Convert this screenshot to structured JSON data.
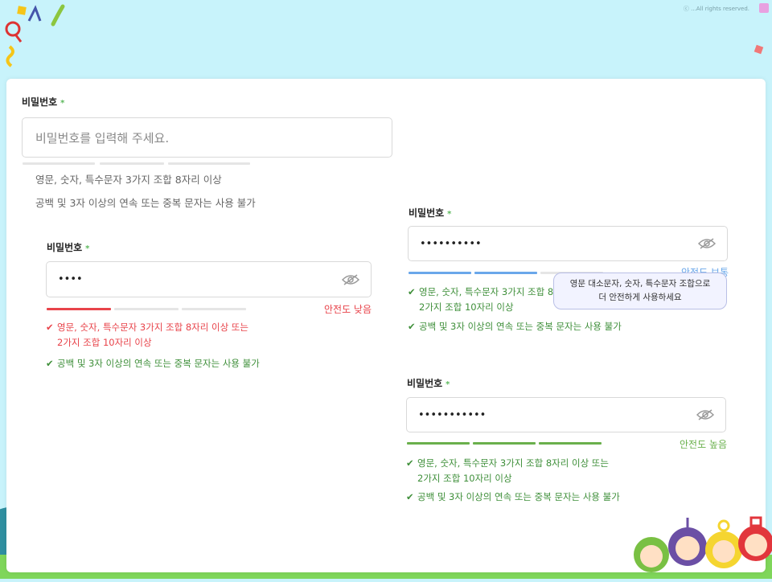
{
  "copyright": "ⓒ ...All rights reserved.",
  "colors": {
    "background": "#c8f3fb",
    "required": "#5cb85c",
    "weak": "#e8434a",
    "medium": "#6aa7ea",
    "strong": "#6ab04c",
    "tooltip_bg": "#f2f3ff"
  },
  "example1": {
    "label": "비밀번호",
    "required_mark": "*",
    "placeholder": "비밀번호를 입력해 주세요.",
    "hint1": "영문, 숫자, 특수문자 3가지 조합 8자리 이상",
    "hint2": "공백 및 3자 이상의 연속 또는 중복 문자는 사용 불가"
  },
  "example2": {
    "label": "비밀번호",
    "required_mark": "*",
    "value": "••••",
    "eye_icon": "eye-icon",
    "strength": "안전도 낮음",
    "strength_level": 1,
    "rule1_mark": "✔",
    "rule1_line1": "영문, 숫자, 특수문자 3가지 조합 8자리 이상 또는",
    "rule1_line2": "2가지 조합 10자리 이상",
    "rule2_mark": "✔",
    "rule2": "공백 및 3자 이상의 연속 또는 중복 문자는 사용 불가"
  },
  "example3": {
    "label": "비밀번호",
    "required_mark": "*",
    "value": "••••••••••",
    "eye_icon": "eye-icon",
    "strength": "안전도 보통",
    "strength_level": 2,
    "rule1_mark": "✔",
    "rule1_line1": "영문, 숫자, 특수문자 3가지 조합 8자리 이상 또는",
    "rule1_line2": "2가지 조합 10자리 이상",
    "rule2_mark": "✔",
    "rule2": "공백 및 3자 이상의 연속 또는 중복 문자는 사용 불가",
    "tooltip_line1": "영문 대소문자, 숫자, 특수문자 조합으로",
    "tooltip_line2": "더 안전하게 사용하세요"
  },
  "example4": {
    "label": "비밀번호",
    "required_mark": "*",
    "value": "•••••••••••",
    "eye_icon": "eye-icon",
    "strength": "안전도 높음",
    "strength_level": 3,
    "rule1_mark": "✔",
    "rule1_line1": "영문, 숫자, 특수문자 3가지 조합 8자리 이상 또는",
    "rule1_line2": "2가지 조합 10자리 이상",
    "rule2_mark": "✔",
    "rule2": "공백 및 3자 이상의 연속 또는 중복 문자는 사용 불가"
  }
}
